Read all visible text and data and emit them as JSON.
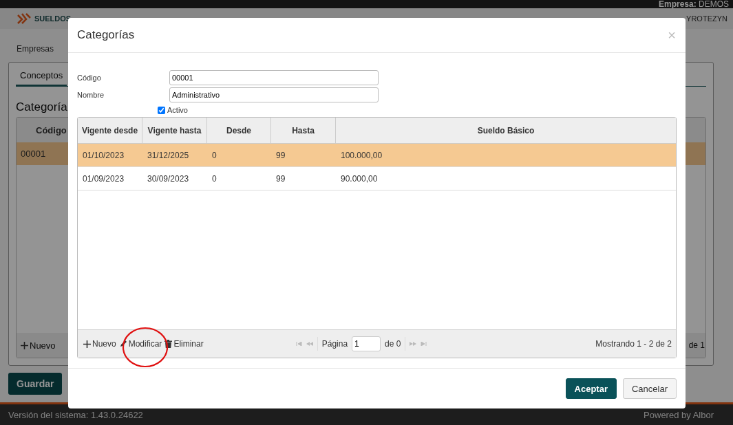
{
  "top_bar": {
    "company": "**Empresa:** DEMOS"
  },
  "header": {
    "logo": "SUELDOS",
    "user": "YROTEZYN"
  },
  "breadcrumb": "Empresas",
  "tabs": [
    {
      "label": "Conceptos",
      "selected": true
    }
  ],
  "section_title": "Categoría",
  "list": {
    "columns": [
      "Código"
    ],
    "rows": [
      {
        "cells": [
          "00001"
        ],
        "selected": true
      }
    ],
    "toolbar": [
      "Nuevo"
    ],
    "pager": "de 1"
  },
  "buttons": [
    "Guardar"
  ],
  "footer": {
    "version": "Versión del sistema: 1.43.0.24622",
    "powered": "Powered by Albor"
  },
  "dialog": {
    "title": "Categorías",
    "close": "×",
    "fields": [
      {
        "label": "Código",
        "value": "00001"
      },
      {
        "label": "Nombre",
        "value": "Administrativo"
      }
    ],
    "active": {
      "label": "Activo",
      "checked": true
    },
    "grid": {
      "columns": [
        "Vigente desde",
        "Vigente hasta",
        "Desde",
        "Hasta",
        "Sueldo Básico"
      ],
      "rows": [
        {
          "cells": [
            "01/10/2023",
            "31/12/2025",
            "0",
            "99",
            "100.000,00"
          ],
          "selected": true
        },
        {
          "cells": [
            "01/09/2023",
            "30/09/2023",
            "0",
            "99",
            "90.000,00"
          ],
          "selected": false
        }
      ],
      "toolbar": [
        {
          "kind": "add",
          "label": "Nuevo"
        },
        {
          "kind": "edit",
          "label": "Modificar"
        },
        {
          "kind": "delete",
          "label": "Eliminar"
        }
      ],
      "pager": {
        "label": "Página",
        "page": "1",
        "total": "de 0"
      },
      "summary": "Mostrando 1 - 2 de 2"
    },
    "buttons": [
      {
        "kind": "primary",
        "label": "Aceptar"
      },
      {
        "kind": "secondary",
        "label": "Cancelar"
      }
    ]
  }
}
